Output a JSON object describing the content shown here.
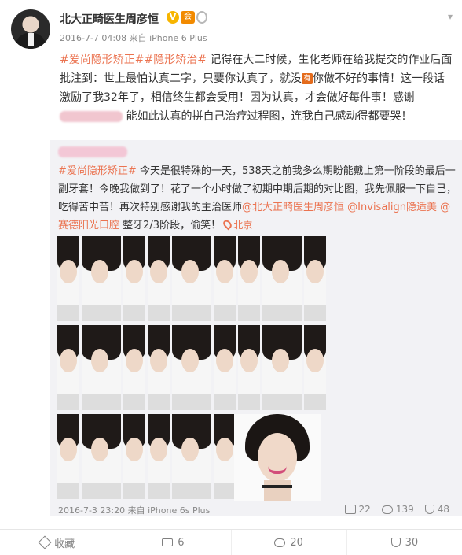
{
  "post": {
    "author": "北大正畸医生周彦恒",
    "verified_icon": "V",
    "vip_icon": "会",
    "meta": "2016-7-7 04:08 来自 iPhone 6 Plus",
    "tag1": "#爱尚隐形矫正#",
    "tag2": "#隐形矫治#",
    "text1": "记得在大二时候，生化老师在给我提交的作业后面批注到：世上最怕认真二字，只要你认真了，就没",
    "inline_emoji": "有",
    "text2": "你做不好的事情！这一段话激励了我32年了，相信终生都会受用！因为认真，才会做好每件事！感谢",
    "text3": "能如此认真的拼自己治疗过程图，连我自己感动得都要哭！"
  },
  "repost": {
    "tag": "#爱尚隐形矫正#",
    "text1": "今天是很特殊的一天，538天之前我多么期盼能戴上第一阶段的最后一副牙套！今晚我做到了！花了一个小时做了初期中期后期的对比图，我先佩服一下自己，吃得苦中苦！再次特别感谢我的主治医师",
    "mention1": "@北大正畸医生周彦恒",
    "mention2": "@Invisalign隐适美",
    "mention3": "@赛德阳光口腔",
    "text2": "整牙2/3阶段，偷笑！",
    "location": "北京",
    "footer_meta": "2016-7-3 23:20 来自 iPhone 6s Plus",
    "reposts": "22",
    "comments": "139",
    "likes": "48"
  },
  "actions": {
    "favorite": "收藏",
    "share": "6",
    "comment": "20",
    "like": "30"
  },
  "colors": {
    "accent": "#eb7350",
    "verified": "#f7b500"
  }
}
